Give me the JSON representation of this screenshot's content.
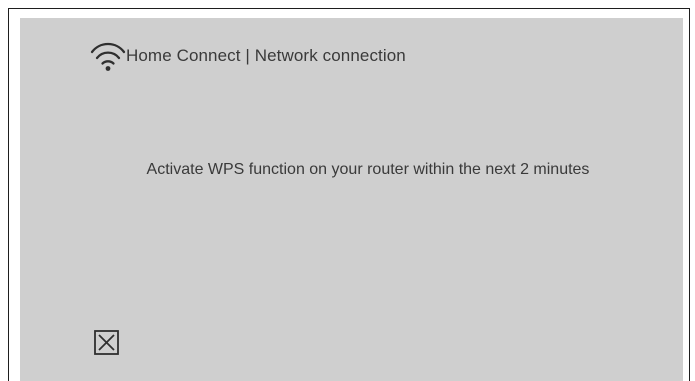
{
  "header": {
    "icon": "wifi-icon",
    "title": "Home Connect | Network connection"
  },
  "message": {
    "text": "Activate WPS function on your router within the next 2 minutes"
  },
  "controls": {
    "close_icon": "close-box-icon"
  },
  "colors": {
    "screen_background": "#cfcfcf",
    "text": "#3a3a3a",
    "frame_border": "#1e1e1e"
  }
}
